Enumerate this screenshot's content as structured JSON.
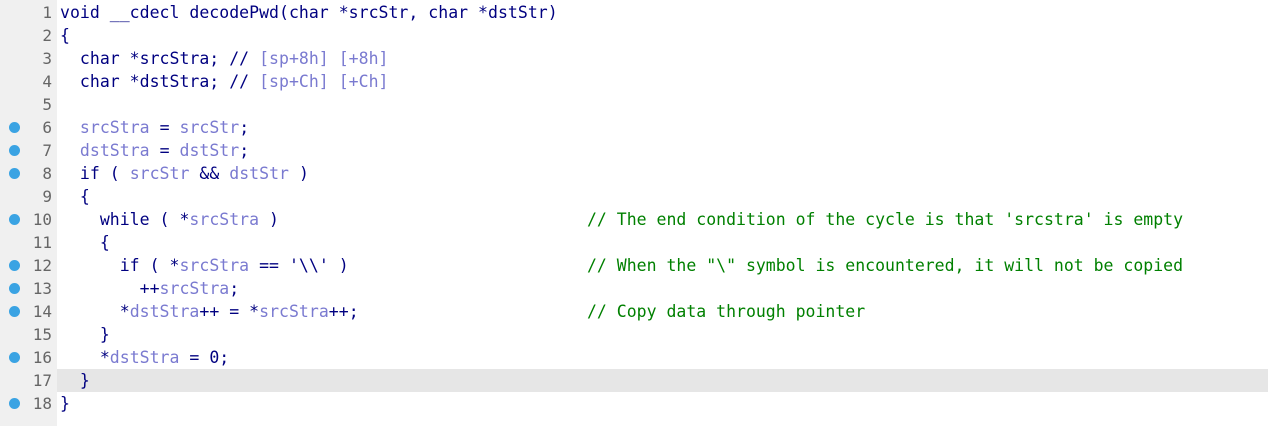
{
  "colors": {
    "keyword": "#000080",
    "variable": "#7a7ad0",
    "comment": "#008000",
    "breakpoint": "#3aa3e3",
    "line_number": "#666666",
    "current_line": "#e6e6e6"
  },
  "lines": [
    {
      "num": "1",
      "bp": false,
      "segments": [
        {
          "t": "void __cdecl decodePwd(char *srcStr, char *dstStr)",
          "c": "ph"
        }
      ],
      "comment": ""
    },
    {
      "num": "2",
      "bp": false,
      "segments": [
        {
          "t": "{",
          "c": "ph"
        }
      ],
      "comment": ""
    },
    {
      "num": "3",
      "bp": false,
      "segments": [
        {
          "t": "  char *srcStra; // ",
          "c": "ph"
        },
        {
          "t": "[sp+8h] [+8h]",
          "c": "cm"
        }
      ],
      "comment": ""
    },
    {
      "num": "4",
      "bp": false,
      "segments": [
        {
          "t": "  char *dstStra; // ",
          "c": "ph"
        },
        {
          "t": "[sp+Ch] [+Ch]",
          "c": "cm"
        }
      ],
      "comment": ""
    },
    {
      "num": "5",
      "bp": false,
      "segments": [],
      "comment": ""
    },
    {
      "num": "6",
      "bp": true,
      "segments": [
        {
          "t": "  ",
          "c": "ph"
        },
        {
          "t": "srcStra",
          "c": "var"
        },
        {
          "t": " = ",
          "c": "ph"
        },
        {
          "t": "srcStr",
          "c": "var"
        },
        {
          "t": ";",
          "c": "ph"
        }
      ],
      "comment": ""
    },
    {
      "num": "7",
      "bp": true,
      "segments": [
        {
          "t": "  ",
          "c": "ph"
        },
        {
          "t": "dstStra",
          "c": "var"
        },
        {
          "t": " = ",
          "c": "ph"
        },
        {
          "t": "dstStr",
          "c": "var"
        },
        {
          "t": ";",
          "c": "ph"
        }
      ],
      "comment": ""
    },
    {
      "num": "8",
      "bp": true,
      "segments": [
        {
          "t": "  if ( ",
          "c": "ph"
        },
        {
          "t": "srcStr",
          "c": "var"
        },
        {
          "t": " && ",
          "c": "ph"
        },
        {
          "t": "dstStr",
          "c": "var"
        },
        {
          "t": " )",
          "c": "ph"
        }
      ],
      "comment": ""
    },
    {
      "num": "9",
      "bp": false,
      "segments": [
        {
          "t": "  {",
          "c": "ph"
        }
      ],
      "comment": ""
    },
    {
      "num": "10",
      "bp": true,
      "segments": [
        {
          "t": "    while ( *",
          "c": "ph"
        },
        {
          "t": "srcStra",
          "c": "var"
        },
        {
          "t": " )",
          "c": "ph"
        }
      ],
      "comment": "// The end condition of the cycle is that 'srcstra' is empty"
    },
    {
      "num": "11",
      "bp": false,
      "segments": [
        {
          "t": "    {",
          "c": "ph"
        }
      ],
      "comment": ""
    },
    {
      "num": "12",
      "bp": true,
      "segments": [
        {
          "t": "      if ( *",
          "c": "ph"
        },
        {
          "t": "srcStra",
          "c": "var"
        },
        {
          "t": " == '\\\\' )",
          "c": "ph"
        }
      ],
      "comment": "// When the \"\\\" symbol is encountered, it will not be copied"
    },
    {
      "num": "13",
      "bp": true,
      "segments": [
        {
          "t": "        ++",
          "c": "ph"
        },
        {
          "t": "srcStra",
          "c": "var"
        },
        {
          "t": ";",
          "c": "ph"
        }
      ],
      "comment": ""
    },
    {
      "num": "14",
      "bp": true,
      "segments": [
        {
          "t": "      *",
          "c": "ph"
        },
        {
          "t": "dstStra",
          "c": "var"
        },
        {
          "t": "++ = *",
          "c": "ph"
        },
        {
          "t": "srcStra",
          "c": "var"
        },
        {
          "t": "++;",
          "c": "ph"
        }
      ],
      "comment": "// Copy data through pointer"
    },
    {
      "num": "15",
      "bp": false,
      "segments": [
        {
          "t": "    }",
          "c": "ph"
        }
      ],
      "comment": ""
    },
    {
      "num": "16",
      "bp": true,
      "segments": [
        {
          "t": "    *",
          "c": "ph"
        },
        {
          "t": "dstStra",
          "c": "var"
        },
        {
          "t": " = 0;",
          "c": "ph"
        }
      ],
      "comment": ""
    },
    {
      "num": "17",
      "bp": false,
      "current": true,
      "segments": [
        {
          "t": "  }",
          "c": "ph"
        }
      ],
      "comment": ""
    },
    {
      "num": "18",
      "bp": true,
      "segments": [
        {
          "t": "}",
          "c": "ph"
        }
      ],
      "comment": ""
    }
  ]
}
